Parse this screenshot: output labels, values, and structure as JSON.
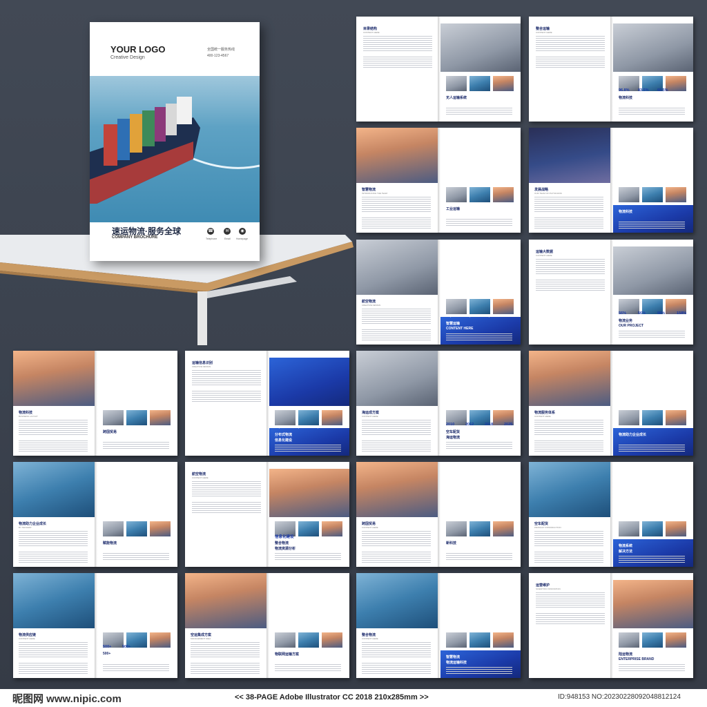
{
  "cover": {
    "logo": "YOUR LOGO",
    "logo_sub": "Creative Design",
    "hotline_label": "全国统一服务热线",
    "hotline_number": "400-123-4567",
    "title_cn": "速运物流·服务全球",
    "title_en": "COMPANY BROCHURE",
    "contacts": [
      "Telephone",
      "Email",
      "Homepage"
    ]
  },
  "spreads": [
    {
      "l": "目录结构",
      "s": "CONTENT HERE",
      "b": "无人运输系统"
    },
    {
      "l": "整合运输",
      "s": "CONTENT HERE",
      "b": "物流科技",
      "n": [
        "96.8%",
        "83.5%",
        "68.5%"
      ]
    },
    {
      "l": "智慧物流",
      "s": "INTRODUCING THE TEAM",
      "b": "工业运输"
    },
    {
      "l": "发展战略",
      "s": "OUR TEAM OF PHYSICIANS",
      "b": "物流科技"
    },
    {
      "l": "航空物流",
      "s": "CREATIVE DESIGN",
      "b": "智慧运输",
      "c": "CONTENT HERE",
      "n": [
        "30,000+",
        "30,000+",
        "85,000+"
      ]
    },
    {
      "l": "运输大数据",
      "s": "CONTENT HERE",
      "b": "物流业务",
      "c": "OUR PROJECT",
      "n": [
        "56%",
        "56%",
        "98%",
        "158%"
      ]
    },
    {
      "l": "物流科技",
      "s": "BUSINESS LAYOUT",
      "b": "跨国贸易"
    },
    {
      "l": "运输信息识别",
      "s": "CREATIVE DESIGN",
      "b": "分布式物流",
      "c": "信息化建设",
      "n": [
        "30,000+",
        "30,000+",
        "85,000+"
      ]
    },
    {
      "l": "海运成方案",
      "s": "CONTENT HERE",
      "b": "空车配货",
      "c": "海运物流",
      "n": [
        "2010",
        "2012",
        "2018",
        "2025"
      ]
    },
    {
      "l": "物流服务体系",
      "s": "CONTENT HERE",
      "b": "物流助力企业成长",
      "n": [
        "20+",
        "80+"
      ]
    },
    {
      "l": "物流助力企业成长",
      "s": "BY TENCENT",
      "b": "赋能物流"
    },
    {
      "l": "航空物流",
      "s": "CONTENT HERE",
      "b": "整合物流",
      "c": "物流资源分析",
      "n": [
        "信息化建设"
      ]
    },
    {
      "l": "跨国贸易",
      "s": "CONTENT HERE",
      "b": "新科技"
    },
    {
      "l": "空车配货",
      "s": "PRODUCT INTRODUCTION",
      "b": "物流系统",
      "c": "解决方法"
    },
    {
      "l": "物流供应链",
      "s": "CONTENT HERE",
      "b": "500+",
      "n": [
        "500+",
        "500+"
      ]
    },
    {
      "l": "空运集成方案",
      "s": "MANAGEMENT IDEA",
      "b": "物联网运输方案"
    },
    {
      "l": "整合物流",
      "s": "CONTENT HERE",
      "b": "智慧物流",
      "c": "物流运输科技"
    },
    {
      "l": "运营维护",
      "s": "SCIENTIFIC INNOVATION",
      "b": "陆运物流",
      "c": "ENTERPRISE BRAND"
    }
  ],
  "footer": {
    "brand": "昵图网 www.nipic.com",
    "spec": "<< 38-PAGE  Adobe Illustrator CC 2018  210x285mm >>",
    "id": "ID:948153 NO:20230228092048812124"
  },
  "colors": {
    "accent": "#1b3aa8",
    "dark": "#1b2a6b",
    "background": "#3f4653"
  }
}
